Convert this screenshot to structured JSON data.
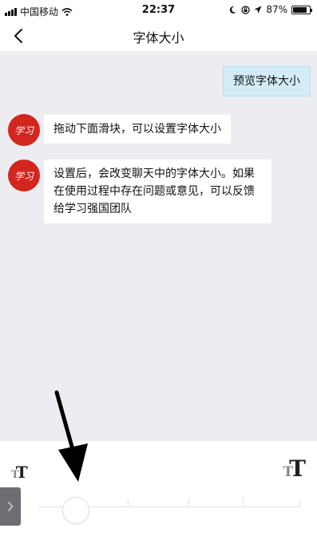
{
  "status_bar": {
    "carrier": "中国移动",
    "time": "22:37",
    "battery": "87%",
    "battery_level": 0.87
  },
  "nav": {
    "title": "字体大小",
    "back_icon": "chevron-left-icon"
  },
  "chat": {
    "preview_message": "预览字体大小",
    "messages": [
      {
        "text": "拖动下面滑块，可以设置字体大小"
      },
      {
        "text": "设置后，会改变聊天中的字体大小。如果在使用过程中存在问题或意见，可以反馈给学习强国团队"
      }
    ],
    "avatar_text": "学习"
  },
  "font_slider": {
    "small_label": "T",
    "large_label": "T",
    "steps": 6,
    "selected_step": 1
  },
  "side_handle": {
    "icon": "chevron-right-icon"
  },
  "colors": {
    "chat_background": "#ededf1",
    "preview_bubble": "#d3ecf8",
    "avatar": "#d2261e"
  }
}
